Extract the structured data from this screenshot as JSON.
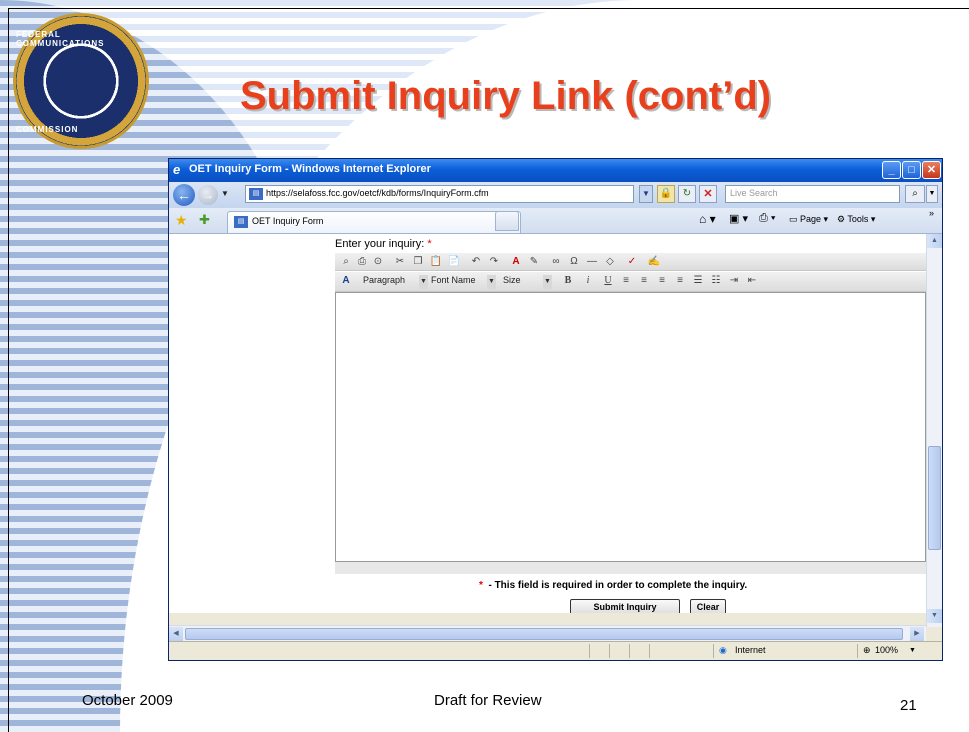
{
  "slide": {
    "title": "Submit Inquiry Link (cont’d)",
    "footer_left": "October 2009",
    "footer_center": "Draft for Review",
    "page_number": "21",
    "title_color": "#e8401c"
  },
  "seal": {
    "text_top": "FEDERAL COMMUNICATIONS",
    "text_bottom": "COMMISSION"
  },
  "browser": {
    "window_title": "OET Inquiry Form - Windows Internet Explorer",
    "address": "https://selafoss.fcc.gov/oetcf/kdb/forms/InquiryForm.cfm",
    "search_placeholder": "Live Search",
    "tab_label": "OET Inquiry Form",
    "commands": {
      "page": "Page",
      "tools": "Tools"
    },
    "status": {
      "zone": "Internet",
      "zoom": "100%"
    }
  },
  "form": {
    "label": "Enter your inquiry:",
    "required_marker": "*",
    "toolbar": {
      "paragraph": "Paragraph",
      "font_name": "Font Name",
      "size": "Size"
    },
    "required_note": "- This field is required in order to complete the inquiry.",
    "submit_label": "Submit Inquiry",
    "clear_label": "Clear"
  }
}
